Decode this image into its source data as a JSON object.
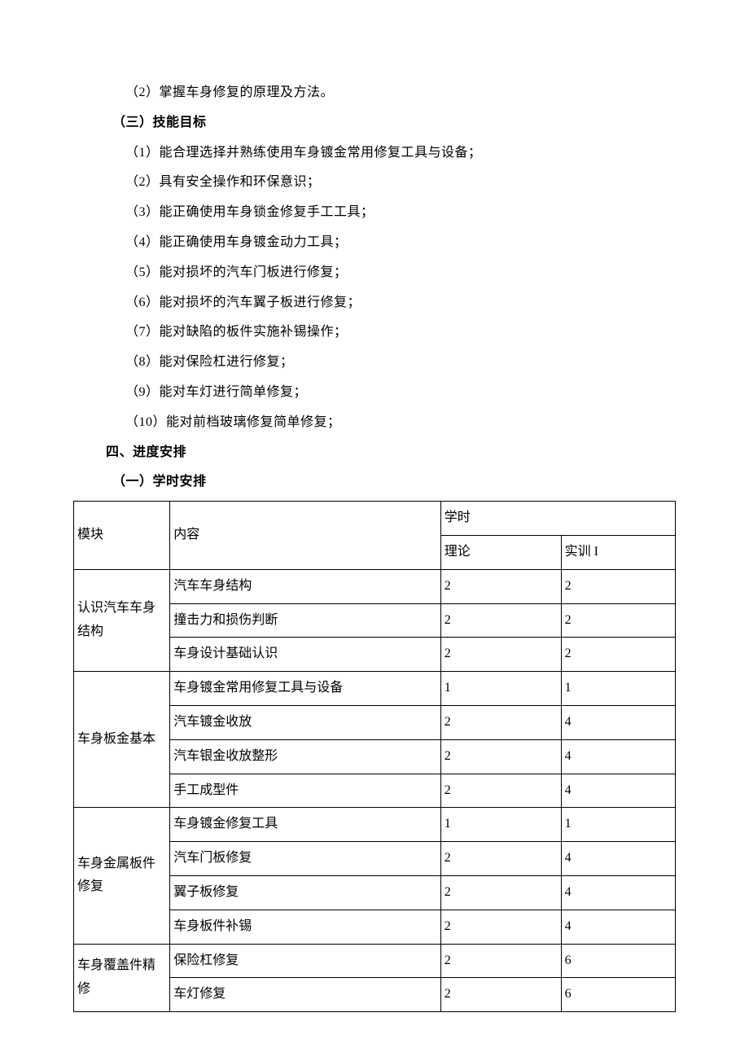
{
  "lines": {
    "l2": "（2）掌握车身修复的原理及方法。",
    "heading_skills": "（三）技能目标",
    "s1": "（1）能合理选择并熟练使用车身镀金常用修复工具与设备；",
    "s2": "（2）具有安全操作和环保意识；",
    "s3": "（3）能正确使用车身锁金修复手工工具；",
    "s4": "（4）能正确使用车身镀金动力工具；",
    "s5": "（5）能对损坏的汽车门板进行修复；",
    "s6": "（6）能对损坏的汽车翼子板进行修复；",
    "s7": "（7）能对缺陷的板件实施补锡操作；",
    "s8": "（8）能对保险杠进行修复；",
    "s9": "（9）能对车灯进行简单修复；",
    "s10": "（10）能对前档玻璃修复简单修复；",
    "heading_schedule": "四、进度安排",
    "heading_hours": "（一）学时安排"
  },
  "table": {
    "header": {
      "module": "模块",
      "content": "内容",
      "hours": "学时",
      "theory": "理论",
      "practice": "实训 I"
    },
    "module1": {
      "name": "认识汽车车身结构",
      "r1": {
        "content": "汽车车身结构",
        "theory": "2",
        "practice": "2"
      },
      "r2": {
        "content": "撞击力和损伤判断",
        "theory": "2",
        "practice": "2"
      },
      "r3": {
        "content": "车身设计基础认识",
        "theory": "2",
        "practice": "2"
      }
    },
    "module2": {
      "name": "车身板金基本",
      "r1": {
        "content": "车身镀金常用修复工具与设备",
        "theory": "1",
        "practice": "1"
      },
      "r2": {
        "content": "汽车镀金收放",
        "theory": "2",
        "practice": "4"
      },
      "r3": {
        "content": "汽车银金收放整形",
        "theory": "2",
        "practice": "4"
      },
      "r4": {
        "content": "手工成型件",
        "theory": "2",
        "practice": "4"
      }
    },
    "module3": {
      "name": "车身金属板件修复",
      "r1": {
        "content": "车身镀金修复工具",
        "theory": "1",
        "practice": "1"
      },
      "r2": {
        "content": "汽车门板修复",
        "theory": "2",
        "practice": "4"
      },
      "r3": {
        "content": "翼子板修复",
        "theory": "2",
        "practice": "4"
      },
      "r4": {
        "content": "车身板件补锡",
        "theory": "2",
        "practice": "4"
      }
    },
    "module4": {
      "name": "车身覆盖件精修",
      "r1": {
        "content": "保险杠修复",
        "theory": "2",
        "practice": "6"
      },
      "r2": {
        "content": "车灯修复",
        "theory": "2",
        "practice": "6"
      }
    }
  }
}
